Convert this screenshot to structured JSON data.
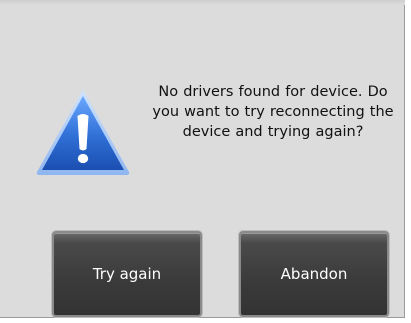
{
  "dialog": {
    "message": "No drivers found for device. Do you want to try reconnecting the device and trying again?",
    "icon": "warning-icon",
    "buttons": {
      "try_again_label": "Try again",
      "abandon_label": "Abandon"
    }
  },
  "colors": {
    "dialog_background": "#dcdcdc",
    "button_background": "#3a3a3a",
    "button_text": "#ffffff",
    "icon_blue": "#2f6fd6",
    "icon_symbol": "#ffffff"
  }
}
